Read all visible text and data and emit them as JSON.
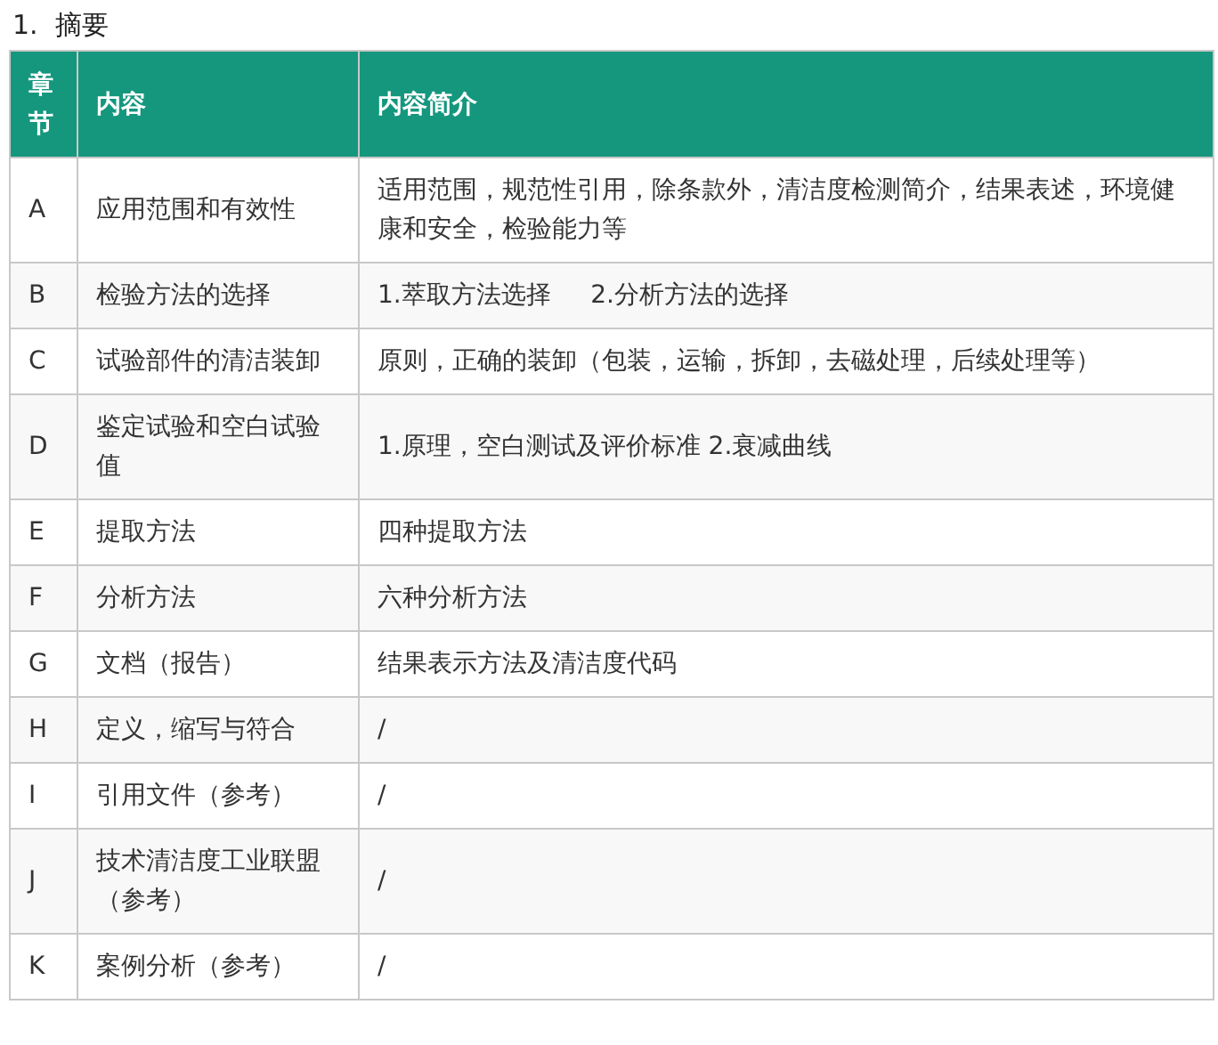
{
  "heading": "1.  摘要",
  "table": {
    "columns": [
      "章节",
      "内容",
      "内容简介"
    ],
    "rows": [
      [
        "A",
        "应用范围和有效性",
        "适用范围，规范性引用，除条款外，清洁度检测简介，结果表述，环境健康和安全，检验能力等"
      ],
      [
        "B",
        "检验方法的选择",
        "1.萃取方法选择     2.分析方法的选择"
      ],
      [
        "C",
        "试验部件的清洁装卸",
        "原则，正确的装卸（包装，运输，拆卸，去磁处理，后续处理等）"
      ],
      [
        "D",
        "鉴定试验和空白试验值",
        "1.原理，空白测试及评价标准 2.衰减曲线"
      ],
      [
        "E",
        "提取方法",
        "四种提取方法"
      ],
      [
        "F",
        "分析方法",
        "六种分析方法"
      ],
      [
        "G",
        "文档（报告）",
        "结果表示方法及清洁度代码"
      ],
      [
        "H",
        "定义，缩写与符合",
        "/"
      ],
      [
        "I",
        "引用文件（参考）",
        "/"
      ],
      [
        "J",
        "技术清洁度工业联盟（参考）",
        "/"
      ],
      [
        "K",
        "案例分析（参考）",
        "/"
      ]
    ]
  }
}
